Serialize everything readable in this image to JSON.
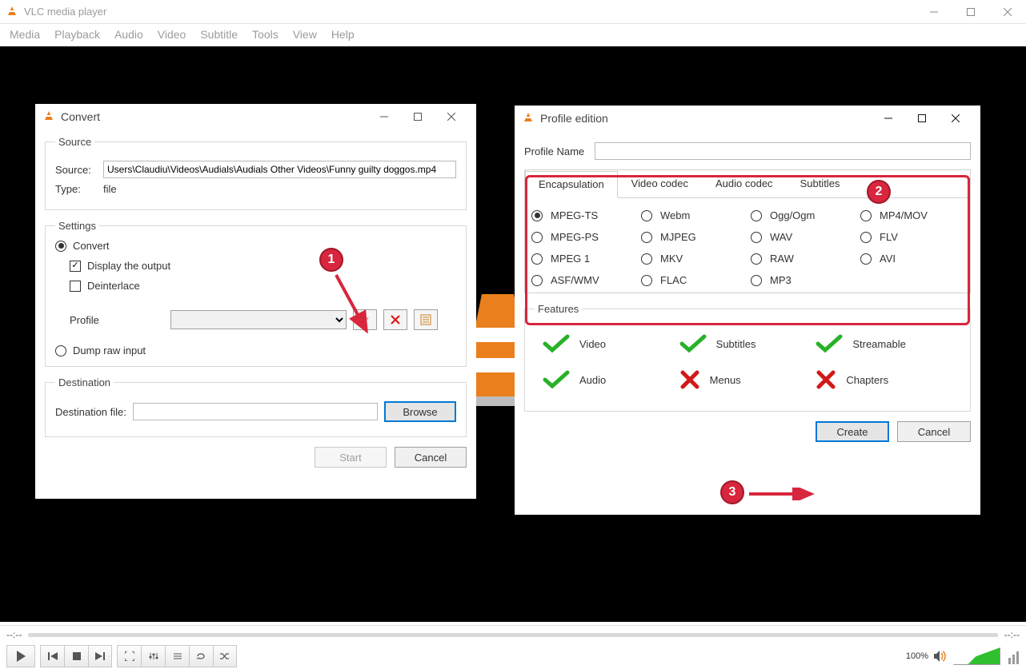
{
  "main": {
    "title": "VLC media player",
    "menus": [
      "Media",
      "Playback",
      "Audio",
      "Video",
      "Subtitle",
      "Tools",
      "View",
      "Help"
    ]
  },
  "convert": {
    "title": "Convert",
    "group_source": "Source",
    "source_label": "Source:",
    "source_value": "Users\\Claudiu\\Videos\\Audials\\Audials Other Videos\\Funny guilty doggos.mp4",
    "type_label": "Type:",
    "type_value": "file",
    "group_settings": "Settings",
    "convert_radio": "Convert",
    "display_cb": "Display the output",
    "deinterlace_cb": "Deinterlace",
    "profile_label": "Profile",
    "dump_radio": "Dump raw input",
    "group_destination": "Destination",
    "dest_label": "Destination file:",
    "browse_btn": "Browse",
    "start_btn": "Start",
    "cancel_btn": "Cancel"
  },
  "profile": {
    "title": "Profile edition",
    "name_label": "Profile Name",
    "tabs": [
      "Encapsulation",
      "Video codec",
      "Audio codec",
      "Subtitles"
    ],
    "encaps": [
      "MPEG-TS",
      "Webm",
      "Ogg/Ogm",
      "MP4/MOV",
      "MPEG-PS",
      "MJPEG",
      "WAV",
      "FLV",
      "MPEG 1",
      "MKV",
      "RAW",
      "AVI",
      "ASF/WMV",
      "FLAC",
      "MP3"
    ],
    "group_features": "Features",
    "features": [
      {
        "label": "Video",
        "ok": true
      },
      {
        "label": "Subtitles",
        "ok": true
      },
      {
        "label": "Streamable",
        "ok": true
      },
      {
        "label": "Audio",
        "ok": true
      },
      {
        "label": "Menus",
        "ok": false
      },
      {
        "label": "Chapters",
        "ok": false
      }
    ],
    "create_btn": "Create",
    "cancel_btn": "Cancel"
  },
  "annotations": {
    "a1": "1",
    "a2": "2",
    "a3": "3"
  },
  "player": {
    "time_l": "--:--",
    "time_r": "--:--",
    "volume": "100%"
  }
}
